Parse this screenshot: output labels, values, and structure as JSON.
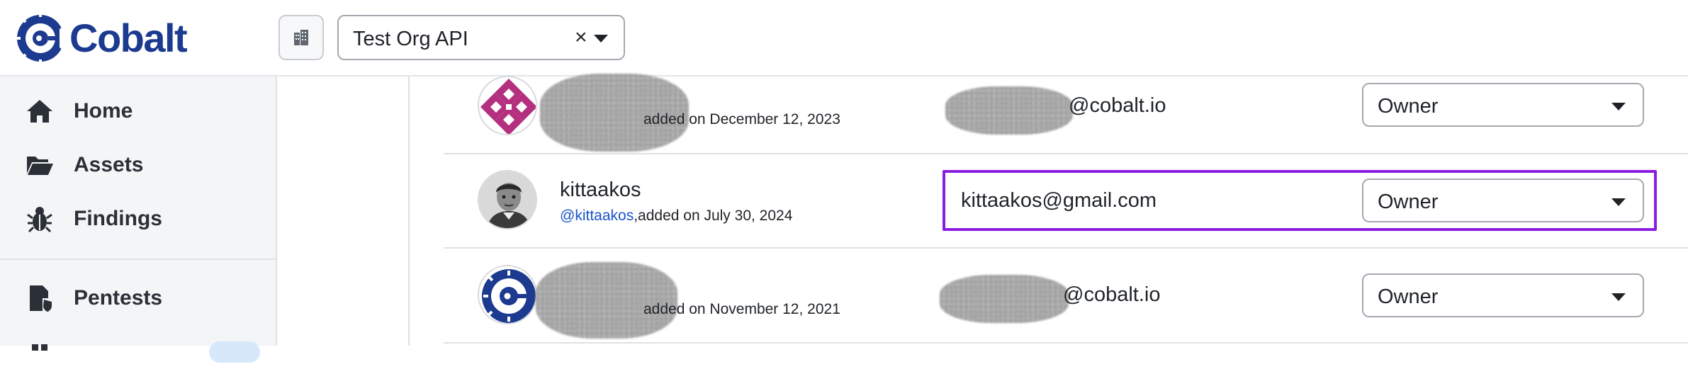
{
  "header": {
    "logo_text": "Cobalt",
    "org_select": {
      "value": "Test Org API",
      "clear_icon": "×"
    }
  },
  "sidebar": {
    "items": [
      {
        "label": "Home",
        "icon": "home-icon"
      },
      {
        "label": "Assets",
        "icon": "folder-open-icon"
      },
      {
        "label": "Findings",
        "icon": "bug-icon"
      },
      {
        "label": "Pentests",
        "icon": "pentest-shield-icon"
      }
    ]
  },
  "members": [
    {
      "name": "",
      "added": "added on December 12, 2023",
      "email_suffix": "@cobalt.io",
      "role": "Owner",
      "redacted": true
    },
    {
      "name": "kittaakos",
      "handle": "@kittaakos",
      "added": ",added on July 30, 2024",
      "email": "kittaakos@gmail.com",
      "role": "Owner",
      "highlighted": true
    },
    {
      "name": "",
      "added": "added on November 12, 2021",
      "email_suffix": "@cobalt.io",
      "role": "Owner",
      "redacted": true
    }
  ],
  "colors": {
    "brand": "#1c3a8f",
    "highlight": "#8a1ee0",
    "link": "#1a53c9"
  }
}
